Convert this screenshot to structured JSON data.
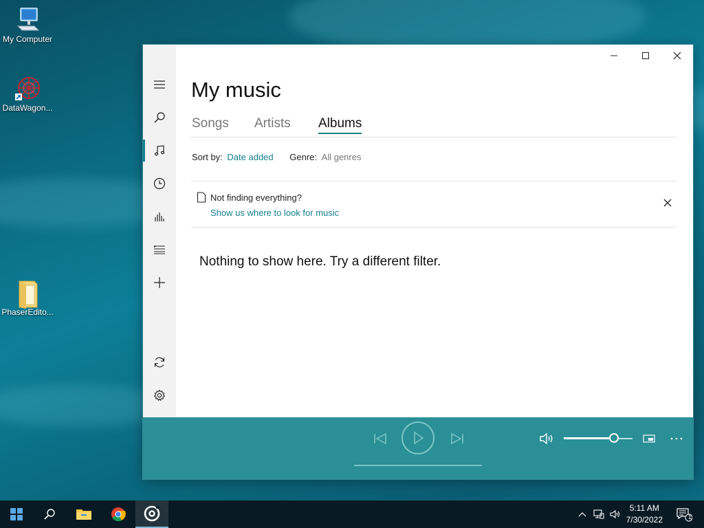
{
  "desktop": {
    "icons": [
      {
        "label": "My Computer"
      },
      {
        "label": "DataWagon..."
      },
      {
        "label": "PhaserEdito..."
      }
    ]
  },
  "app": {
    "title": "My music",
    "tabs": [
      {
        "label": "Songs"
      },
      {
        "label": "Artists"
      },
      {
        "label": "Albums",
        "active": true
      }
    ],
    "filters": {
      "sort_label": "Sort by:",
      "sort_value": "Date added",
      "genre_label": "Genre:",
      "genre_value": "All genres"
    },
    "notice": {
      "title": "Not finding everything?",
      "link": "Show us where to look for music"
    },
    "empty_message": "Nothing to show here. Try a different filter.",
    "player": {
      "volume": 0.73
    },
    "accent_color": "#17808f",
    "player_color": "#2a8f96"
  },
  "taskbar": {
    "time": "5:11 AM",
    "date": "7/30/2022",
    "notification_count": "1"
  }
}
